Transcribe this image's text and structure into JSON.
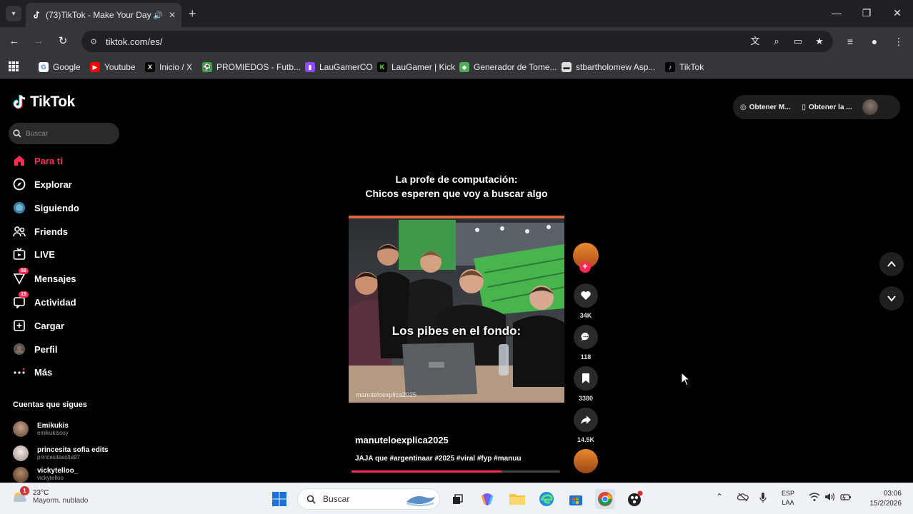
{
  "browser": {
    "tab_title": "(73)TikTok - Make Your Day",
    "url": "tiktok.com/es/",
    "bookmarks": [
      {
        "label": "Google",
        "color": "#ffffff"
      },
      {
        "label": "Youtube",
        "color": "#ff0000"
      },
      {
        "label": "Inicio / X",
        "color": "#000000"
      },
      {
        "label": "PROMIEDOS - Futb...",
        "color": "#3aa53a"
      },
      {
        "label": "LauGamerCO",
        "color": "#9146ff"
      },
      {
        "label": "LauGamer | Kick",
        "color": "#53fc18"
      },
      {
        "label": "Generador de Tome...",
        "color": "#4caf50"
      },
      {
        "label": "stbartholomew Asp...",
        "color": "#222222"
      },
      {
        "label": "TikTok",
        "color": "#000000"
      }
    ]
  },
  "tiktok": {
    "logo": "TikTok",
    "search_placeholder": "Buscar",
    "nav": [
      {
        "label": "Para ti",
        "icon": "home-icon",
        "active": true,
        "badge": ""
      },
      {
        "label": "Explorar",
        "icon": "compass-icon",
        "active": false,
        "badge": ""
      },
      {
        "label": "Siguiendo",
        "icon": "following-icon",
        "active": false,
        "badge": ""
      },
      {
        "label": "Friends",
        "icon": "friends-icon",
        "active": false,
        "badge": ""
      },
      {
        "label": "LIVE",
        "icon": "live-icon",
        "active": false,
        "badge": ""
      },
      {
        "label": "Mensajes",
        "icon": "messages-icon",
        "active": false,
        "badge": "58"
      },
      {
        "label": "Actividad",
        "icon": "activity-icon",
        "active": false,
        "badge": "15"
      },
      {
        "label": "Cargar",
        "icon": "upload-icon",
        "active": false,
        "badge": ""
      },
      {
        "label": "Perfil",
        "icon": "profile-icon",
        "active": false,
        "badge": ""
      },
      {
        "label": "Más",
        "icon": "more-icon",
        "active": false,
        "badge": ""
      }
    ],
    "following_title": "Cuentas que sigues",
    "following": [
      {
        "name": "Emikukis",
        "handle": "emikukissoy"
      },
      {
        "name": "princesita sofia edits",
        "handle": "princesitasofia97"
      },
      {
        "name": "vickytelloo_",
        "handle": "vickytelloo"
      }
    ],
    "top_pill": {
      "left": "Obtener M...",
      "right": "Obtener la ..."
    },
    "video": {
      "caption_line1": "La profe de computación:",
      "caption_line2": "Chicos esperen que voy a buscar algo",
      "overlay_text": "Los pibes en el fondo:",
      "watermark": "manuteloexplica2025",
      "username": "manuteloexplica2025",
      "description": "JAJA que #argentinaar #2025 #viral #fyp #manuu",
      "progress": 0.72
    },
    "actions": {
      "likes": "34K",
      "comments": "118",
      "saves": "3380",
      "shares": "14.5K"
    },
    "accent": "#fe2c55"
  },
  "taskbar": {
    "temp": "23°C",
    "condition": "Mayorm. nublado",
    "weather_badge": "1",
    "search_label": "Buscar",
    "lang_top": "ESP",
    "lang_bottom": "LAA",
    "time": "03:06",
    "date": "15/2/2026"
  }
}
